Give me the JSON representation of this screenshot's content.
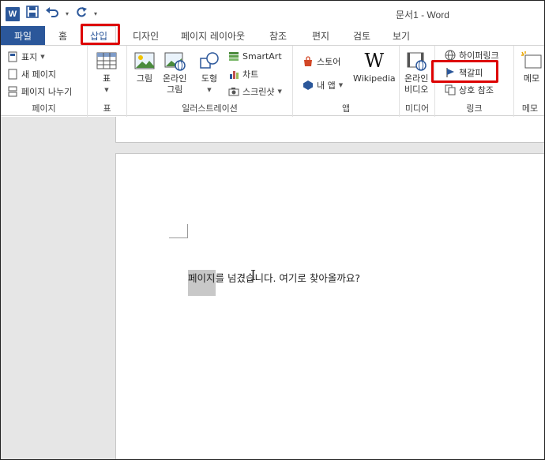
{
  "window": {
    "title": "문서1 - Word"
  },
  "qat": {
    "logo_letter": "W"
  },
  "tabs": {
    "file": "파일",
    "items": [
      "홈",
      "삽입",
      "디자인",
      "페이지 레이아웃",
      "참조",
      "편지",
      "검토",
      "보기"
    ],
    "active": "삽입"
  },
  "ribbon": {
    "pages": {
      "cover": "표지",
      "blank": "새 페이지",
      "break": "페이지 나누기",
      "label": "페이지"
    },
    "table": {
      "btn": "표",
      "label": "표"
    },
    "illustrations": {
      "picture": "그림",
      "online_picture_1": "온라인",
      "online_picture_2": "그림",
      "shapes": "도형",
      "smartart": "SmartArt",
      "chart": "차트",
      "screenshot": "스크린샷",
      "label": "일러스트레이션"
    },
    "apps": {
      "store": "스토어",
      "myapps": "내 앱",
      "wikipedia": "Wikipedia",
      "label": "앱"
    },
    "media": {
      "video_1": "온라인",
      "video_2": "비디오",
      "label": "미디어"
    },
    "links": {
      "hyperlink": "하이퍼링크",
      "bookmark": "책갈피",
      "crossref": "상호 참조",
      "label": "링크"
    },
    "comments": {
      "comment": "메모",
      "label": "메모"
    }
  },
  "document": {
    "selected": "페이지",
    "text": "를 넘겼습니다. 여기로 찾아올까요?"
  },
  "colors": {
    "accent": "#2b579a",
    "highlight": "#dd0000"
  }
}
